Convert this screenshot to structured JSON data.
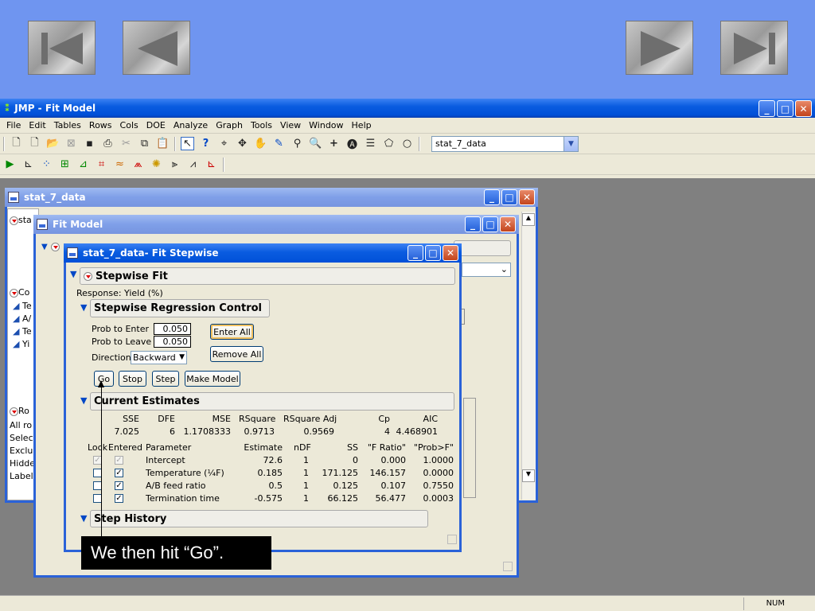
{
  "nav": {
    "first_icon": "first-slide-icon",
    "prev_icon": "previous-slide-icon",
    "next_icon": "next-slide-icon",
    "last_icon": "last-slide-icon"
  },
  "app": {
    "title": "JMP - Fit Model",
    "menu": [
      "File",
      "Edit",
      "Tables",
      "Rows",
      "Cols",
      "DOE",
      "Analyze",
      "Graph",
      "Tools",
      "View",
      "Window",
      "Help"
    ],
    "table_combo": "stat_7_data",
    "status_num": "NUM"
  },
  "data_window": {
    "title": "stat_7_data",
    "side_labels": [
      "sta",
      "Co",
      "Te",
      "A/",
      "Te",
      "Yi",
      "Ro",
      "All ro",
      "Select",
      "Exclu",
      "Hidde",
      "Label"
    ]
  },
  "fit_model": {
    "title": "Fit Model"
  },
  "stepwise": {
    "title": "stat_7_data- Fit Stepwise",
    "outline_title": "Stepwise Fit",
    "response": "Response: Yield (%)",
    "control_title": "Stepwise Regression Control",
    "prob_enter_label": "Prob to Enter",
    "prob_enter": "0.050",
    "prob_leave_label": "Prob to Leave",
    "prob_leave": "0.050",
    "direction_label": "Direction:",
    "direction": "Backward",
    "enter_all": "Enter All",
    "remove_all": "Remove All",
    "go": "Go",
    "stop": "Stop",
    "step": "Step",
    "make_model": "Make Model",
    "estimates_title": "Current Estimates",
    "summary_headers": [
      "SSE",
      "DFE",
      "MSE",
      "RSquare",
      "RSquare Adj",
      "Cp",
      "AIC"
    ],
    "summary_values": [
      "7.025",
      "6",
      "1.1708333",
      "0.9713",
      "0.9569",
      "4",
      "4.468901"
    ],
    "param_headers": [
      "Lock",
      "Entered",
      "Parameter",
      "Estimate",
      "nDF",
      "SS",
      "\"F Ratio\"",
      "\"Prob>F\""
    ],
    "rows": [
      {
        "lock": "✓",
        "entered": "✓",
        "parameter": "Intercept",
        "estimate": "72.6",
        "ndf": "1",
        "ss": "0",
        "f": "0.000",
        "p": "1.0000"
      },
      {
        "lock": "",
        "entered": "✓",
        "parameter": "Temperature (¼F)",
        "estimate": "0.185",
        "ndf": "1",
        "ss": "171.125",
        "f": "146.157",
        "p": "0.0000"
      },
      {
        "lock": "",
        "entered": "✓",
        "parameter": "A/B feed ratio",
        "estimate": "0.5",
        "ndf": "1",
        "ss": "0.125",
        "f": "0.107",
        "p": "0.7550"
      },
      {
        "lock": "",
        "entered": "✓",
        "parameter": "Termination time",
        "estimate": "-0.575",
        "ndf": "1",
        "ss": "66.125",
        "f": "56.477",
        "p": "0.0003"
      }
    ],
    "history_title": "Step History"
  },
  "caption": "We then hit “Go”."
}
